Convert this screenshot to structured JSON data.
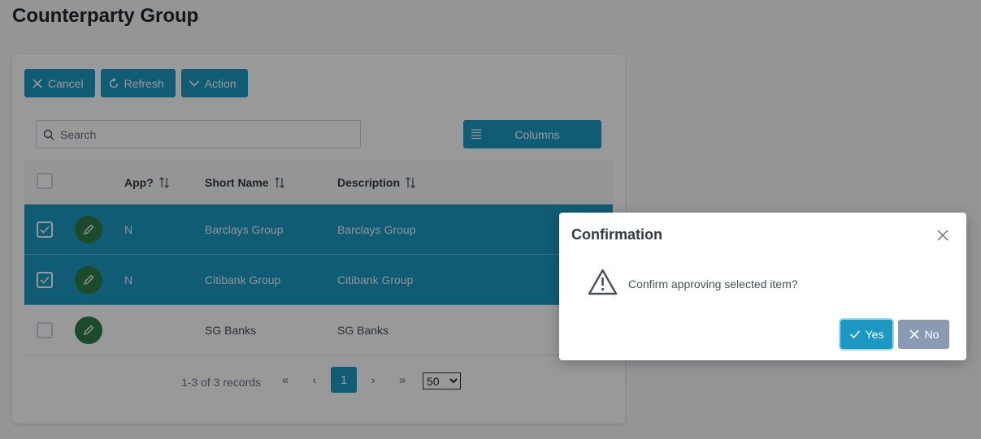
{
  "page": {
    "title": "Counterparty Group"
  },
  "toolbar": {
    "cancel_label": "Cancel",
    "refresh_label": "Refresh",
    "action_label": "Action"
  },
  "search": {
    "placeholder": "Search"
  },
  "columns_button": {
    "label": "Columns"
  },
  "table": {
    "headers": {
      "approved": "App?",
      "short_name": "Short Name",
      "description": "Description"
    },
    "rows": [
      {
        "selected": true,
        "approved": "N",
        "short_name": "Barclays Group",
        "description": "Barclays Group"
      },
      {
        "selected": true,
        "approved": "N",
        "short_name": "Citibank Group",
        "description": "Citibank Group"
      },
      {
        "selected": false,
        "approved": "",
        "short_name": "SG Banks",
        "description": "SG Banks"
      }
    ]
  },
  "pagination": {
    "report": "1-3 of 3 records",
    "current_page": "1",
    "rows_per_page": "50"
  },
  "dialog": {
    "title": "Confirmation",
    "message": "Confirm approving selected item?",
    "yes_label": "Yes",
    "no_label": "No"
  },
  "colors": {
    "accent": "#1c99c3",
    "edit_button": "#2f7d4a",
    "no_button": "#8a9ab3"
  }
}
